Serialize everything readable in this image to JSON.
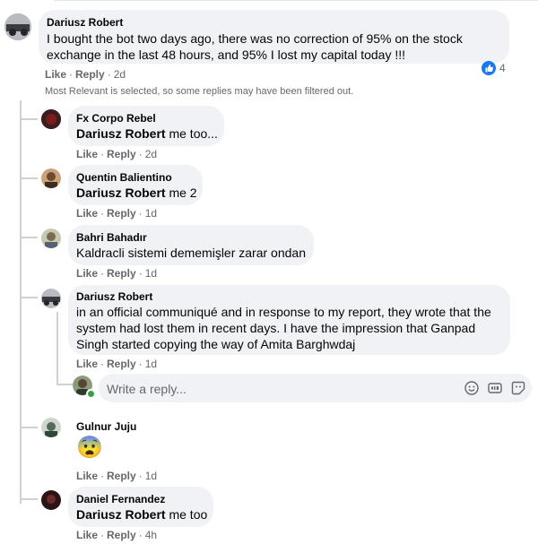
{
  "top_comment": {
    "author": "Dariusz Robert",
    "text": "I bought the bot two days ago, there was no correction of 95% on the stock exchange in the last 48 hours, and 95% I lost my capital today !!!",
    "like": "Like",
    "reply": "Reply",
    "dot": "·",
    "time": "2d",
    "reaction_count": "4"
  },
  "filter_note": "Most Relevant is selected, so some replies may have been filtered out.",
  "replies": [
    {
      "author": "Fx Corpo Rebel",
      "mention": "Dariusz Robert",
      "text": " me too...",
      "like": "Like",
      "reply": "Reply",
      "dot": "·",
      "time": "2d"
    },
    {
      "author": "Quentin Balientino",
      "mention": "Dariusz Robert",
      "text": " me 2",
      "like": "Like",
      "reply": "Reply",
      "dot": "·",
      "time": "1d"
    },
    {
      "author": "Bahri Bahadır",
      "text": "Kaldracli sistemi dememişler zarar ondan",
      "like": "Like",
      "reply": "Reply",
      "dot": "·",
      "time": "1d"
    },
    {
      "author": "Dariusz Robert",
      "text": "in an official communiqué and in response to my report, they wrote that the system had lost them in recent days. I have the impression that Ganpad Singh started copying the way of Amita Barghwdaj",
      "like": "Like",
      "reply": "Reply",
      "dot": "·",
      "time": "1d"
    },
    {
      "author": "Gulnur Juju",
      "emoji": "😨",
      "like": "Like",
      "reply": "Reply",
      "dot": "·",
      "time": "1d"
    },
    {
      "author": "Daniel Fernandez",
      "mention": "Dariusz Robert",
      "text": " me too",
      "like": "Like",
      "reply": "Reply",
      "dot": "·",
      "time": "4h"
    }
  ],
  "reply_box": {
    "placeholder": "Write a reply..."
  },
  "icons": {
    "like_reaction": "thumbs-up-icon",
    "emoji": "smiley-icon",
    "gif": "gif-icon",
    "sticker": "sticker-icon"
  },
  "colors": {
    "accent": "#1877f2",
    "bubble": "#f0f2f5",
    "meta": "#65676b"
  }
}
